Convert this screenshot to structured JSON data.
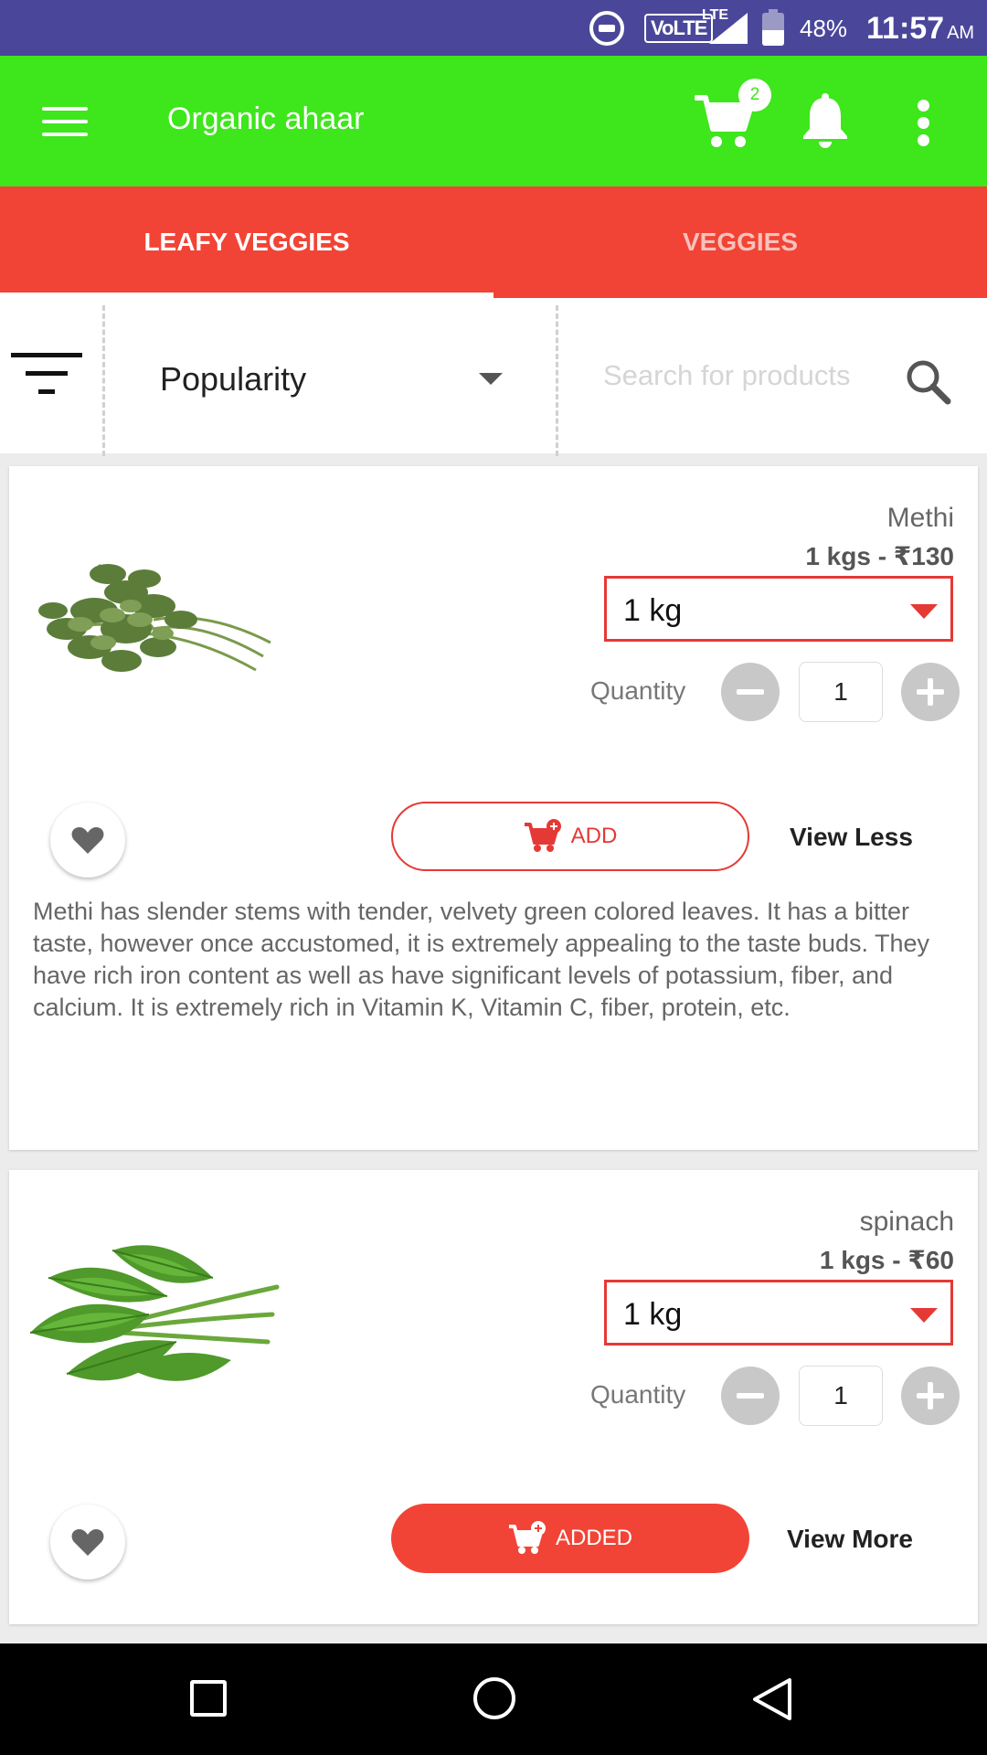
{
  "status_bar": {
    "network": "VoLTE",
    "lte": "LTE",
    "battery_percent_text": "48%",
    "battery_level": 0.48,
    "time": "11:57",
    "ampm": "AM"
  },
  "app_bar": {
    "title": "Organic ahaar",
    "cart_count": "2"
  },
  "tabs": [
    {
      "label": "LEAFY VEGGIES",
      "active": true
    },
    {
      "label": "VEGGIES",
      "active": false
    }
  ],
  "filter": {
    "sort_value": "Popularity",
    "search_placeholder": "Search for products",
    "search_value": ""
  },
  "products": [
    {
      "name": "Methi",
      "price": "1 kgs - ₹130",
      "unit": "1 kg",
      "quantity_label": "Quantity",
      "quantity": "1",
      "add_label": "ADD",
      "add_state": "outline",
      "view_label": "View Less",
      "description": "Methi has slender stems with tender, velvety green colored leaves. It has a bitter taste, however once accustomed, it is extremely appealing to the taste buds. They have rich iron content as well as have significant levels of potassium, fiber, and calcium. It is extremely rich in Vitamin K, Vitamin C, fiber, protein, etc."
    },
    {
      "name": "spinach",
      "price": "1 kgs - ₹60",
      "unit": "1 kg",
      "quantity_label": "Quantity",
      "quantity": "1",
      "add_label": "ADDED",
      "add_state": "filled",
      "view_label": "View More"
    }
  ],
  "colors": {
    "status_bar": "#4a479a",
    "app_bar": "#3ee61c",
    "tab_bar": "#f14436",
    "accent_red": "#e53935"
  }
}
